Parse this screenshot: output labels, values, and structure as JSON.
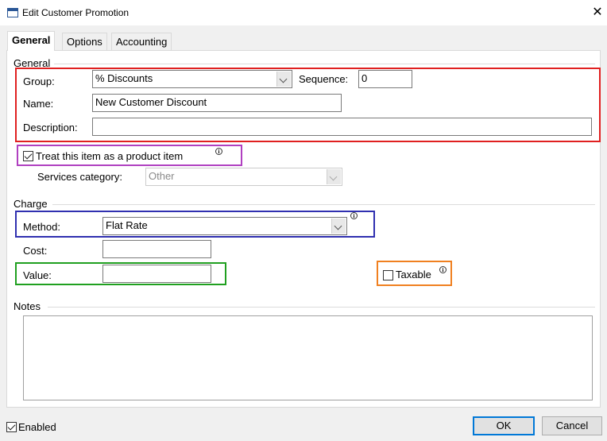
{
  "window": {
    "title": "Edit Customer Promotion",
    "close_glyph": "✕"
  },
  "tabs": [
    {
      "label": "General",
      "active": true
    },
    {
      "label": "Options",
      "active": false
    },
    {
      "label": "Accounting",
      "active": false
    }
  ],
  "general_group": {
    "title": "General",
    "group_label": "Group:",
    "group_value": "% Discounts",
    "sequence_label": "Sequence:",
    "sequence_value": "0",
    "name_label": "Name:",
    "name_value": "New Customer Discount",
    "description_label": "Description:",
    "description_value": "",
    "product_item_label": "Treat this item as a product item",
    "product_item_checked": true,
    "services_category_label": "Services category:",
    "services_category_value": "Other"
  },
  "charge_group": {
    "title": "Charge",
    "method_label": "Method:",
    "method_value": "Flat Rate",
    "cost_label": "Cost:",
    "cost_value": "",
    "value_label": "Value:",
    "value_value": "",
    "taxable_label": "Taxable",
    "taxable_checked": false
  },
  "notes": {
    "title": "Notes",
    "value": ""
  },
  "footer": {
    "enabled_label": "Enabled",
    "enabled_checked": true,
    "ok_label": "OK",
    "cancel_label": "Cancel"
  },
  "info_glyph": "i",
  "highlight_colors": {
    "general_fields": "#e02020",
    "product_item": "#b040c0",
    "method": "#3030b0",
    "value": "#20a020",
    "taxable": "#f08020"
  }
}
